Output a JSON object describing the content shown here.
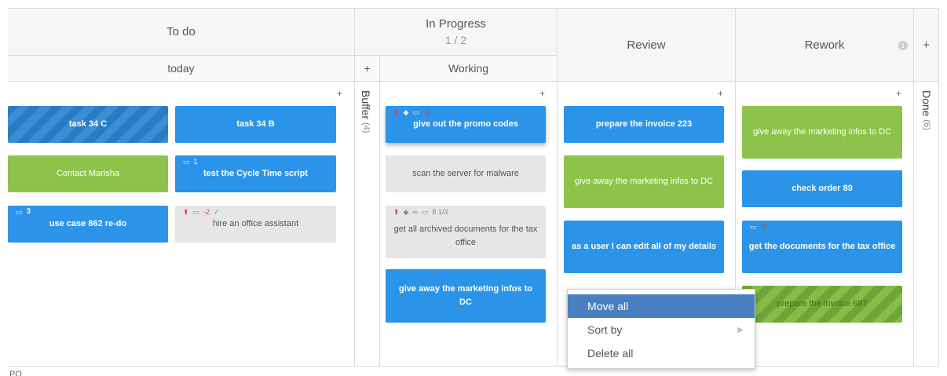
{
  "columns": {
    "todo": {
      "title": "To do",
      "sub": "today"
    },
    "inprogress": {
      "title": "In Progress",
      "count": "1 / 2",
      "sub": "Working"
    },
    "review": {
      "title": "Review"
    },
    "rework": {
      "title": "Rework"
    },
    "buffer": {
      "label": "Buffer",
      "count": "(4)"
    },
    "done": {
      "label": "Done",
      "count": "(6)"
    }
  },
  "plus": "+",
  "info_icon": "i",
  "footer_text": "PO",
  "cards": {
    "task34c": "task 34 C",
    "task34b": "task 34 B",
    "contact": "Contact Marisha",
    "cycle": "test the Cycle Time script",
    "cycle_meta": "1",
    "usecase": "use case 862 re-do",
    "usecase_meta": "3",
    "hire": "hire an office assistant",
    "hire_meta": "-2",
    "promo": "give out the promo codes",
    "promo_meta": "-1",
    "scan": "scan the server for malware",
    "archive": "get all archived documents for the tax office",
    "archive_meta": "8  1/3",
    "giveaway_dc": "give away the marketing infos to DC",
    "invoice223": "prepare the invoice 223",
    "marketing_review": "give away the marketing infos to DC",
    "edit_details": "as a user I can edit all of my details",
    "rework_marketing": "give away the marketing infos to DC",
    "order89": "check order 89",
    "tax_docs": "get the documents for the tax office",
    "tax_meta": "-8",
    "invoice687": "prepare the invoice 687"
  },
  "context_menu": {
    "move_all": "Move all",
    "sort_by": "Sort by",
    "delete_all": "Delete all"
  },
  "icons": [
    "priority-icon",
    "tag-icon",
    "calendar-icon",
    "link-icon",
    "check-icon",
    "info-icon",
    "chevron-right-icon"
  ]
}
